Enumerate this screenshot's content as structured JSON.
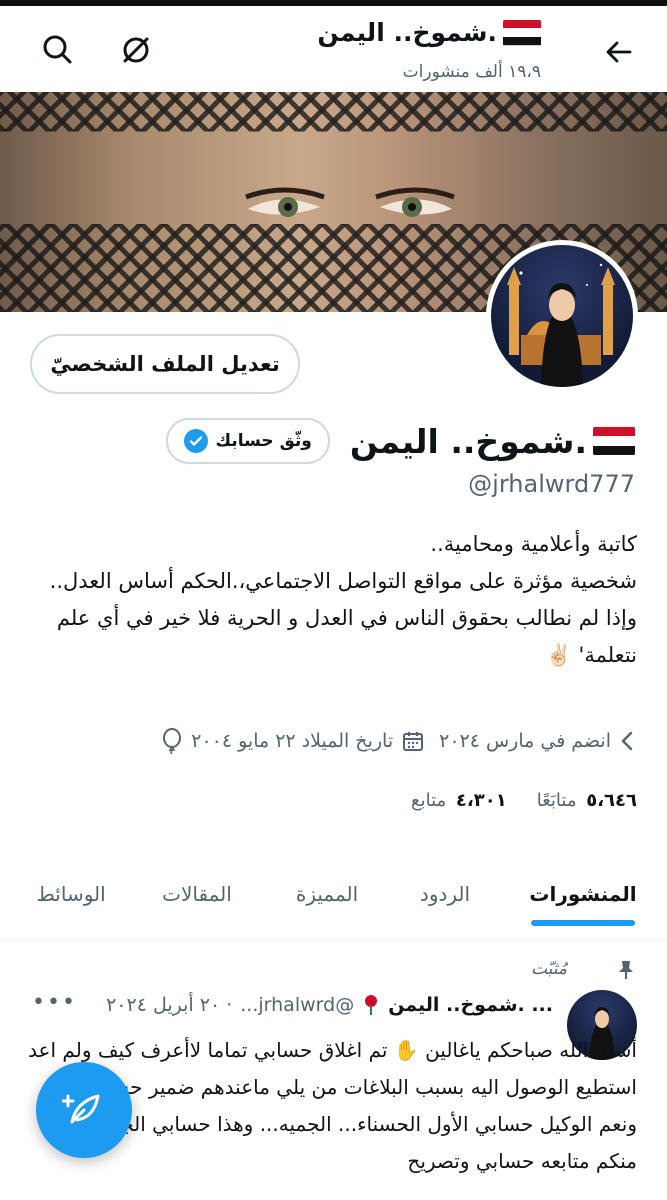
{
  "header": {
    "title": ".شموخ.. اليمن",
    "subtitle": "١٩،٩ ألف منشورات"
  },
  "profile": {
    "edit_button": "تعديل الملف الشخصيّ",
    "name": ".شموخ.. اليمن",
    "verify_label": "وثّق حسابك",
    "handle": "@jrhalwrd777",
    "bio_lines": [
      "كاتبة وأعلامية ومحامية..",
      "شخصية مؤثرة على مواقع التواصل الاجتماعي،.الحكم أساس العدل..",
      "وإذا لم نطالب بحقوق الناس في العدل و الحرية فلا خير في أي علم نتعلمة' ✌🏻"
    ],
    "joined": "انضم في مارس ٢٠٢٤",
    "birthdate": "تاريخ الميلاد ٢٢ مايو ٢٠٠٤",
    "following_count": "٥،٦٤٦",
    "following_label": "متابَعًا",
    "followers_count": "٤،٣٠١",
    "followers_label": "متابع"
  },
  "tabs": [
    "المنشورات",
    "الردود",
    "المميزة",
    "المقالات",
    "الوسائط"
  ],
  "post": {
    "pinned_label": "مُثبّت",
    "author": "... .شموخ.. اليمن",
    "handle": "@jrhalwrd...",
    "date": "· ٢٠ أبريل ٢٠٢٤",
    "more": "•••",
    "text": "أسعد الله صباحكم ياغالين ✋ تم اغلاق حسابي تماما لاأعرف كيف ولم اعد استطيع الوصول اليه بسبب البلاغات من يلي ماعندهم ضمير حسبي الله ونعم الوكيل حسابي الأول الحسناء... الجميه... وهذا حسابي الجديد ارجوا منكم متابعه حسابي وتصريح"
  },
  "colors": {
    "accent": "#1d9bf0",
    "text": "#0f1419",
    "secondary": "#536471"
  },
  "icons": [
    "back-arrow-icon",
    "search-icon",
    "link-off-icon",
    "yemen-flag-icon",
    "rose-icon",
    "verified-badge-icon",
    "birthday-balloon-icon",
    "calendar-icon",
    "chevron-icon",
    "pin-icon",
    "compose-icon"
  ]
}
